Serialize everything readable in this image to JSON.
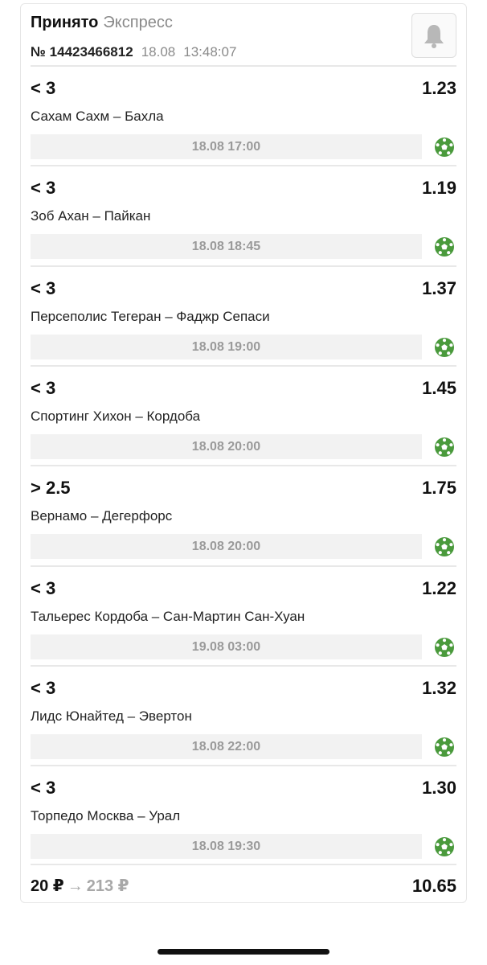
{
  "header": {
    "status": "Принято",
    "bet_type": "Экспресс",
    "bet_number": "№ 14423466812",
    "date": "18.08",
    "time": "13:48:07",
    "bell_icon": "bell-icon"
  },
  "events": [
    {
      "outcome": "< 3",
      "odds": "1.23",
      "teams": "Сахам Сахм – Бахла",
      "datetime": "18.08 17:00",
      "sport_icon": "soccer-ball-icon"
    },
    {
      "outcome": "< 3",
      "odds": "1.19",
      "teams": "Зоб Ахан – Пайкан",
      "datetime": "18.08 18:45",
      "sport_icon": "soccer-ball-icon"
    },
    {
      "outcome": "< 3",
      "odds": "1.37",
      "teams": "Персеполис Тегеран – Фаджр Сепаси",
      "datetime": "18.08 19:00",
      "sport_icon": "soccer-ball-icon"
    },
    {
      "outcome": "< 3",
      "odds": "1.45",
      "teams": "Спортинг Хихон – Кордоба",
      "datetime": "18.08 20:00",
      "sport_icon": "soccer-ball-icon"
    },
    {
      "outcome": "> 2.5",
      "odds": "1.75",
      "teams": "Вернамо – Дегерфорс",
      "datetime": "18.08 20:00",
      "sport_icon": "soccer-ball-icon"
    },
    {
      "outcome": "< 3",
      "odds": "1.22",
      "teams": "Тальерес Кордоба – Сан-Мартин Сан-Хуан",
      "datetime": "19.08 03:00",
      "sport_icon": "soccer-ball-icon"
    },
    {
      "outcome": "< 3",
      "odds": "1.32",
      "teams": "Лидс Юнайтед – Эвертон",
      "datetime": "18.08 22:00",
      "sport_icon": "soccer-ball-icon"
    },
    {
      "outcome": "< 3",
      "odds": "1.30",
      "teams": "Торпедо Москва – Урал",
      "datetime": "18.08 19:30",
      "sport_icon": "soccer-ball-icon"
    }
  ],
  "footer": {
    "stake": "20 ₽",
    "arrow": "→",
    "possible_win": "213 ₽",
    "total_odds": "10.65"
  },
  "colors": {
    "sport_icon": "#4a9a3c",
    "muted": "#8a8a8a",
    "datebar_bg": "#f2f2f2"
  }
}
